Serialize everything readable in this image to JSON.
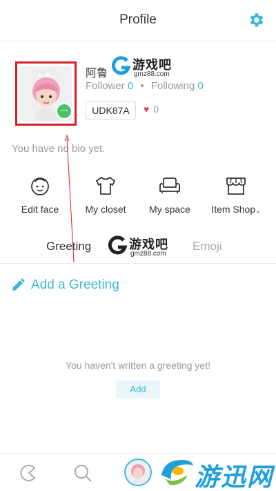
{
  "header": {
    "title": "Profile",
    "settings_icon": "gear-icon"
  },
  "profile": {
    "name": "阿鲁",
    "follower_label": "Follower",
    "follower_count": "0",
    "following_label": "Following",
    "following_count": "0",
    "user_id": "UDK87A",
    "likes_count": "0",
    "bio": "You have no bio yet."
  },
  "actions": [
    {
      "label": "Edit face",
      "icon": "face-icon"
    },
    {
      "label": "My closet",
      "icon": "shirt-icon"
    },
    {
      "label": "My space",
      "icon": "sofa-icon"
    },
    {
      "label": "Item Shop",
      "icon": "shop-icon"
    }
  ],
  "tabs": {
    "greeting": "Greeting",
    "emoji": "Emoji"
  },
  "greeting": {
    "add_title": "Add a Greeting",
    "empty_text": "You haven't written a greeting yet!",
    "add_button": "Add"
  },
  "watermarks": {
    "cn_text": "游戏吧",
    "url": "gmz88.com",
    "bottom_text": "游迅网"
  },
  "colors": {
    "accent": "#3db8d9",
    "highlight_box": "#d41f26",
    "heart": "#e94062",
    "chat_badge": "#4fc06a"
  }
}
